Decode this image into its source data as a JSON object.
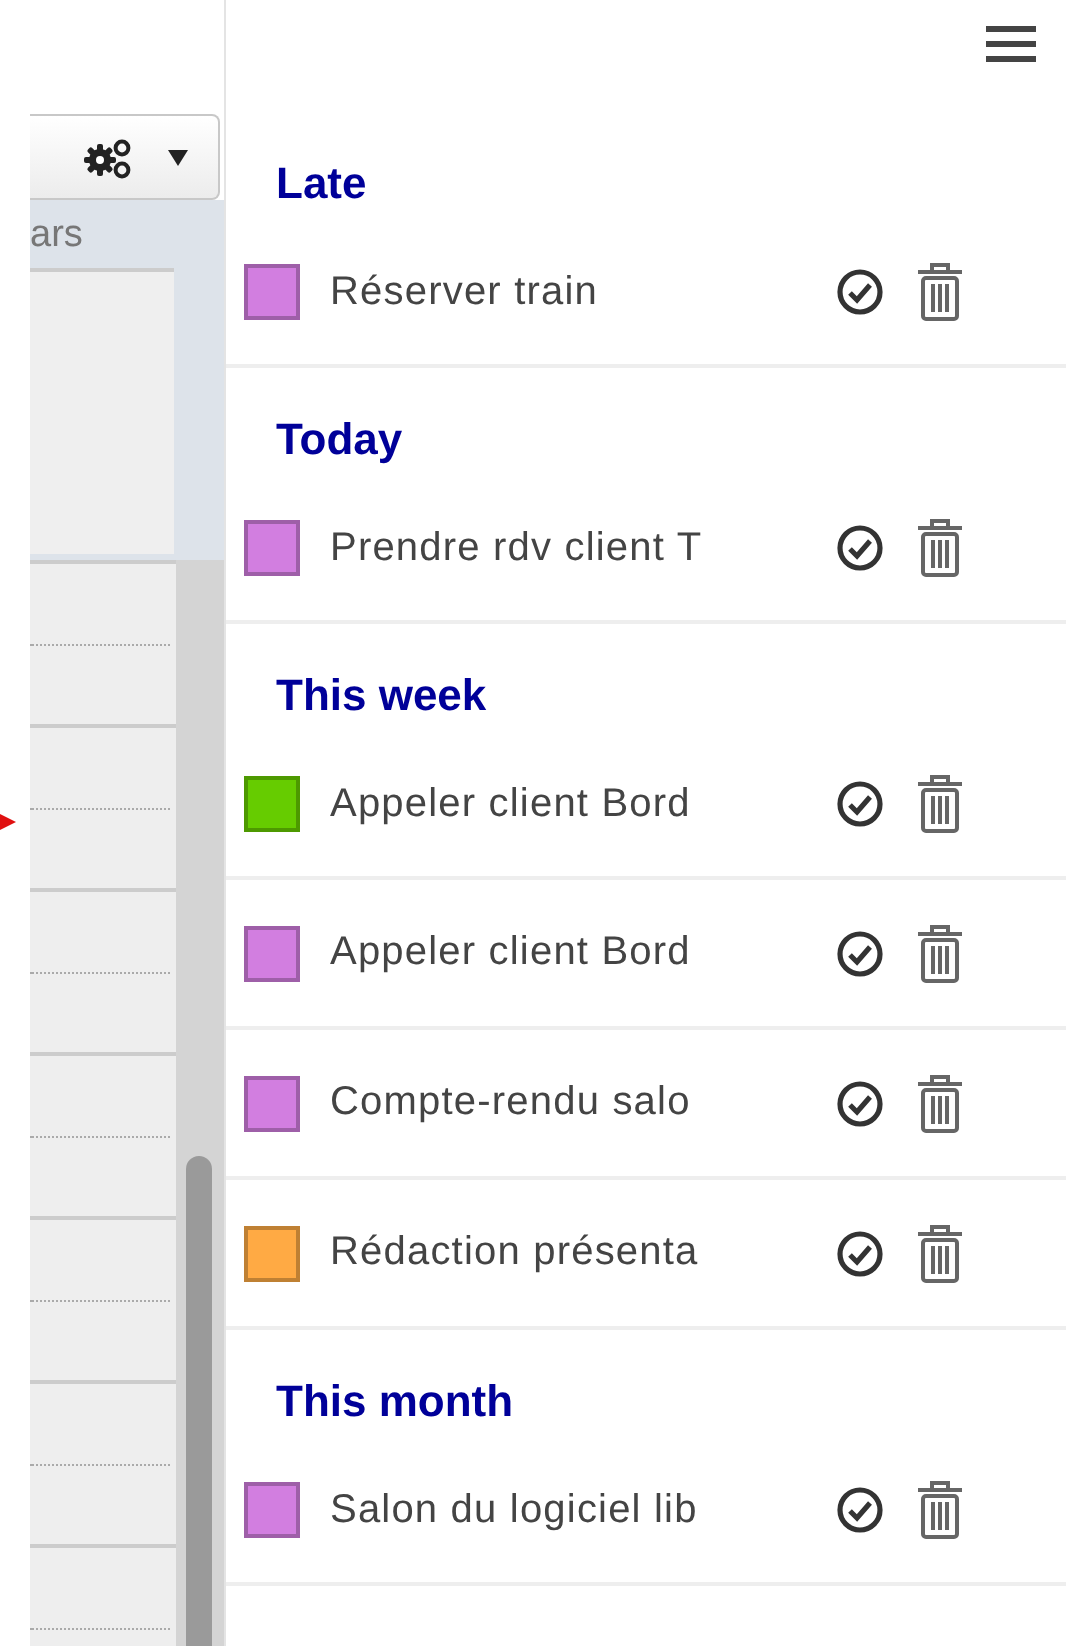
{
  "toolbar": {
    "column_header": "ars"
  },
  "sections": [
    {
      "title": "Late",
      "tasks": [
        {
          "name": "Réserver train",
          "color": "#d27ee0"
        }
      ]
    },
    {
      "title": "Today",
      "tasks": [
        {
          "name": "Prendre rdv client T",
          "color": "#d27ee0"
        }
      ]
    },
    {
      "title": "This week",
      "tasks": [
        {
          "name": "Appeler client Bord",
          "color": "#66cc00"
        },
        {
          "name": "Appeler client Bord",
          "color": "#d27ee0"
        },
        {
          "name": "Compte-rendu salo",
          "color": "#d27ee0"
        },
        {
          "name": "Rédaction présenta",
          "color": "#ffaa44"
        }
      ]
    },
    {
      "title": "This month",
      "tasks": [
        {
          "name": "Salon du logiciel lib",
          "color": "#d27ee0"
        }
      ]
    }
  ]
}
